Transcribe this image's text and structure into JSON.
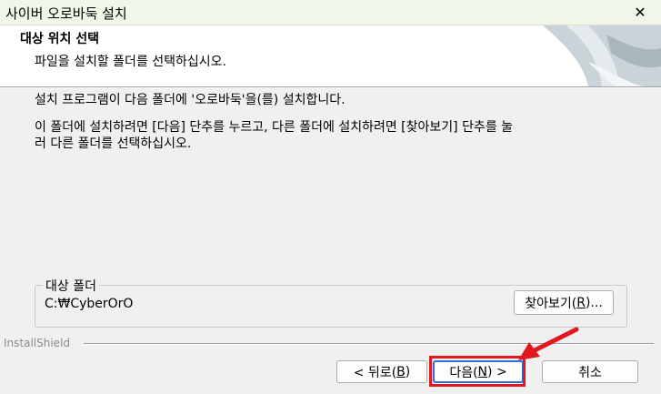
{
  "window": {
    "title": "사이버 오로바둑 설치",
    "close_glyph": "✕"
  },
  "header": {
    "title": "대상 위치 선택",
    "subtitle": "파일을 설치할 폴더를 선택하십시오."
  },
  "body": {
    "line1": "설치 프로그램이 다음 폴더에 '오로바둑'을(를) 설치합니다.",
    "line2": "이 폴더에 설치하려면 [다음] 단추를 누르고, 다른 폴더에 설치하려면 [찾아보기] 단추를 눌",
    "line3": "러 다른 폴더를 선택하십시오."
  },
  "destination": {
    "group_label": "대상 폴더",
    "path": "C:₩CyberOrO",
    "browse": {
      "prefix": "찾아보기(",
      "accel": "R",
      "suffix": ")..."
    }
  },
  "footer": {
    "brand": "InstallShield",
    "back": {
      "prefix": "< 뒤로(",
      "accel": "B",
      "suffix": ")"
    },
    "next": {
      "prefix": "다음(",
      "accel": "N",
      "suffix": ") >"
    },
    "cancel": "취소"
  },
  "colors": {
    "annotation": "#e3171e",
    "focus_border": "#2f6fd4"
  }
}
